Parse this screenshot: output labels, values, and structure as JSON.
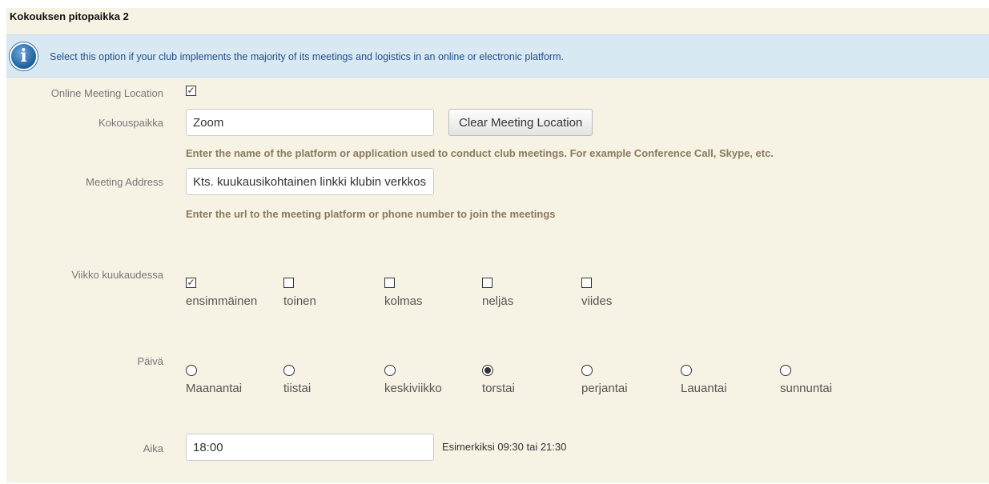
{
  "section": {
    "title": "Kokouksen pitopaikka 2",
    "info_text": "Select this option if your club implements the majority of its meetings and logistics in an online or electronic platform.",
    "info_icon": "i"
  },
  "online": {
    "label": "Online Meeting Location",
    "checked": true
  },
  "location": {
    "label": "Kokouspaikka",
    "value": "Zoom",
    "clear_button": "Clear Meeting Location",
    "help": "Enter the name of the platform or application used to conduct club meetings. For example Conference Call, Skype, etc."
  },
  "address": {
    "label": "Meeting Address",
    "value": "Kts. kuukausikohtainen linkki klubin verkkosivuilta",
    "help": "Enter the url to the meeting platform or phone number to join the meetings"
  },
  "week": {
    "label": "Viikko kuukaudessa",
    "options": [
      {
        "label": "ensimmäinen",
        "checked": true
      },
      {
        "label": "toinen",
        "checked": false
      },
      {
        "label": "kolmas",
        "checked": false
      },
      {
        "label": "neljäs",
        "checked": false
      },
      {
        "label": "viides",
        "checked": false
      }
    ]
  },
  "day": {
    "label": "Päivä",
    "options": [
      {
        "label": "Maanantai",
        "checked": false
      },
      {
        "label": "tiistai",
        "checked": false
      },
      {
        "label": "keskiviikko",
        "checked": false
      },
      {
        "label": "torstai",
        "checked": true
      },
      {
        "label": "perjantai",
        "checked": false
      },
      {
        "label": "Lauantai",
        "checked": false
      },
      {
        "label": "sunnuntai",
        "checked": false
      }
    ]
  },
  "time": {
    "label": "Aika",
    "value": "18:00",
    "hint": "Esimerkiksi 09:30 tai 21:30"
  }
}
